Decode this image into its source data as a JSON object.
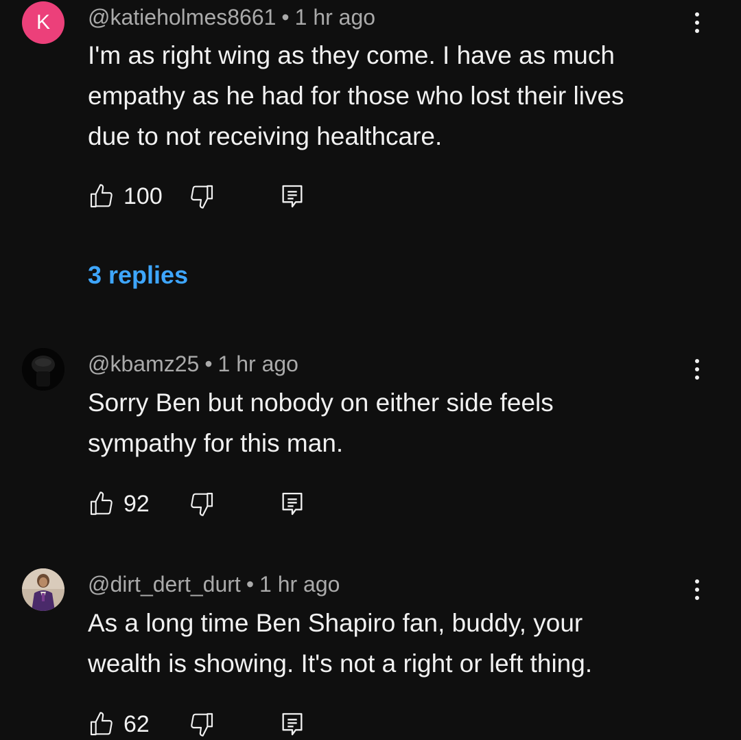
{
  "comments": [
    {
      "avatar_letter": "K",
      "avatar_color": "#ec407a",
      "handle": "@katieholmes8661",
      "separator": "•",
      "time": "1 hr ago",
      "lines": [
        "I'm as right wing as they come. I have as much",
        "empathy as he had for those who lost their lives",
        "due to not receiving healthcare."
      ],
      "likes": "100",
      "replies": "3 replies"
    },
    {
      "avatar_icon": "dark-silhouette-avatar",
      "handle": "@kbamz25",
      "separator": "•",
      "time": "1 hr ago",
      "lines": [
        "Sorry Ben but nobody on either side feels",
        "sympathy for this man."
      ],
      "likes": "92"
    },
    {
      "avatar_icon": "person-in-purple-suit-avatar",
      "handle": "@dirt_dert_durt",
      "separator": "•",
      "time": "1 hr ago",
      "lines": [
        "As a long time Ben Shapiro fan, buddy, your",
        "wealth is showing. It's not a right or left thing."
      ],
      "likes": "62"
    }
  ],
  "colors": {
    "background": "#0f0f0f",
    "text": "#f1f1f1",
    "meta": "#aaaaaa",
    "link": "#3ea6ff"
  },
  "icons": {
    "like": "thumbs-up-icon",
    "dislike": "thumbs-down-icon",
    "reply": "reply-comment-icon",
    "menu": "more-vertical-icon"
  }
}
